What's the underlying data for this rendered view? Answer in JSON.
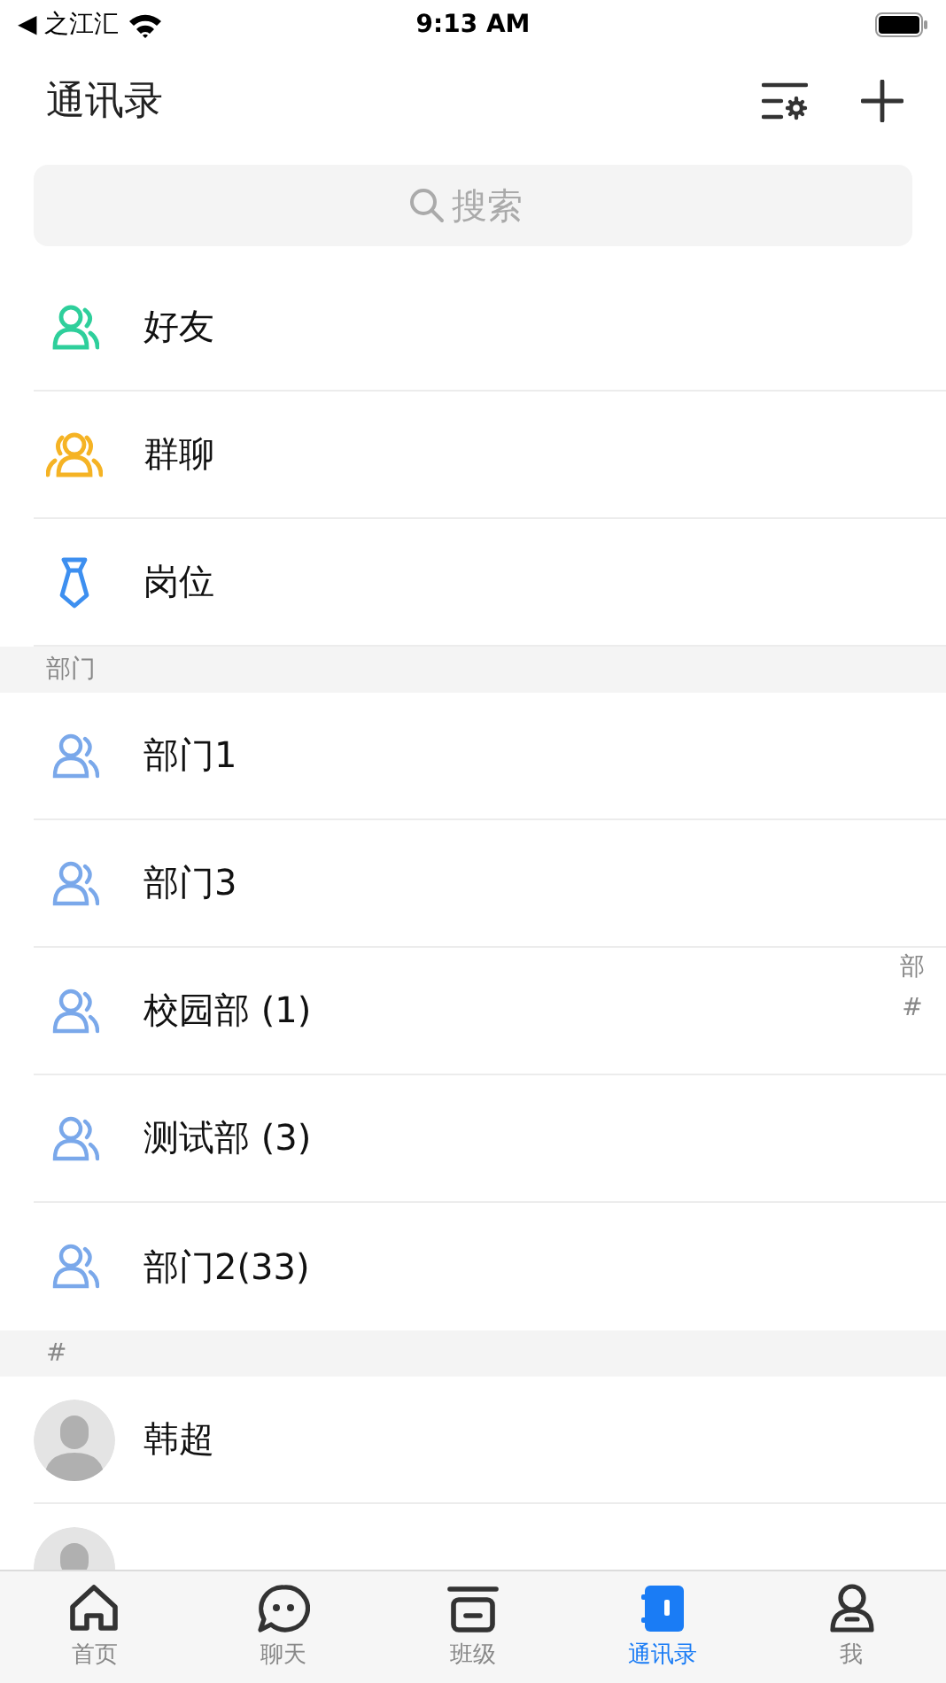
{
  "status_bar": {
    "back_label": "◀ 之江汇",
    "time": "9:13 AM"
  },
  "header": {
    "title": "通讯录"
  },
  "search": {
    "placeholder": "搜索"
  },
  "entries": [
    {
      "kind": "friend",
      "label": "好友",
      "color": "#2ecf9b"
    },
    {
      "kind": "group",
      "label": "群聊",
      "color": "#f5b324"
    },
    {
      "kind": "post",
      "label": "岗位",
      "color": "#3d8ff0"
    }
  ],
  "sections": [
    {
      "title": "部门",
      "items": [
        {
          "kind": "dept",
          "label": "部门1"
        },
        {
          "kind": "dept",
          "label": "部门3"
        },
        {
          "kind": "dept",
          "label": "校园部 (1)"
        },
        {
          "kind": "dept",
          "label": "测试部 (3)"
        },
        {
          "kind": "dept",
          "label": "部门2(33)"
        }
      ]
    },
    {
      "title": "#",
      "items": [
        {
          "kind": "person",
          "label": "韩超"
        },
        {
          "kind": "person"
        }
      ]
    }
  ],
  "index_bar": [
    "部",
    "#"
  ],
  "tabs": [
    {
      "kind": "home",
      "label": "首页",
      "selected": false
    },
    {
      "kind": "chat",
      "label": "聊天",
      "selected": false
    },
    {
      "kind": "class",
      "label": "班级",
      "selected": false
    },
    {
      "kind": "contacts",
      "label": "通讯录",
      "selected": true
    },
    {
      "kind": "me",
      "label": "我",
      "selected": false
    }
  ]
}
